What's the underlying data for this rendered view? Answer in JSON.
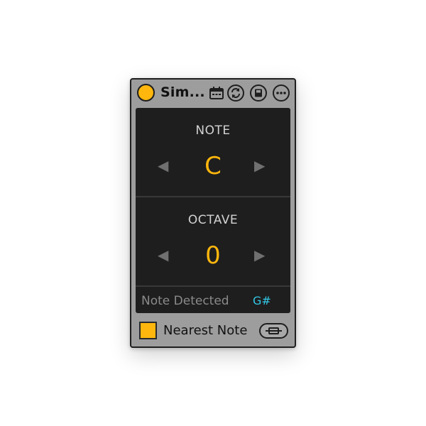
{
  "device": {
    "title": "Sim...",
    "accent_color": "#ffb70d",
    "detected_color": "#32c8e6",
    "icons": [
      "calendar-icon",
      "refresh-icon",
      "save-icon",
      "more-icon"
    ]
  },
  "note": {
    "label": "NOTE",
    "value": "C",
    "prev_arrow": "◀",
    "next_arrow": "▶"
  },
  "octave": {
    "label": "OCTAVE",
    "value": "0",
    "prev_arrow": "◀",
    "next_arrow": "▶"
  },
  "detection": {
    "label": "Note Detected",
    "value": "G#"
  },
  "nearest": {
    "label": "Nearest Note",
    "checked": true
  },
  "map_button": {
    "icon": "mapping-icon"
  }
}
